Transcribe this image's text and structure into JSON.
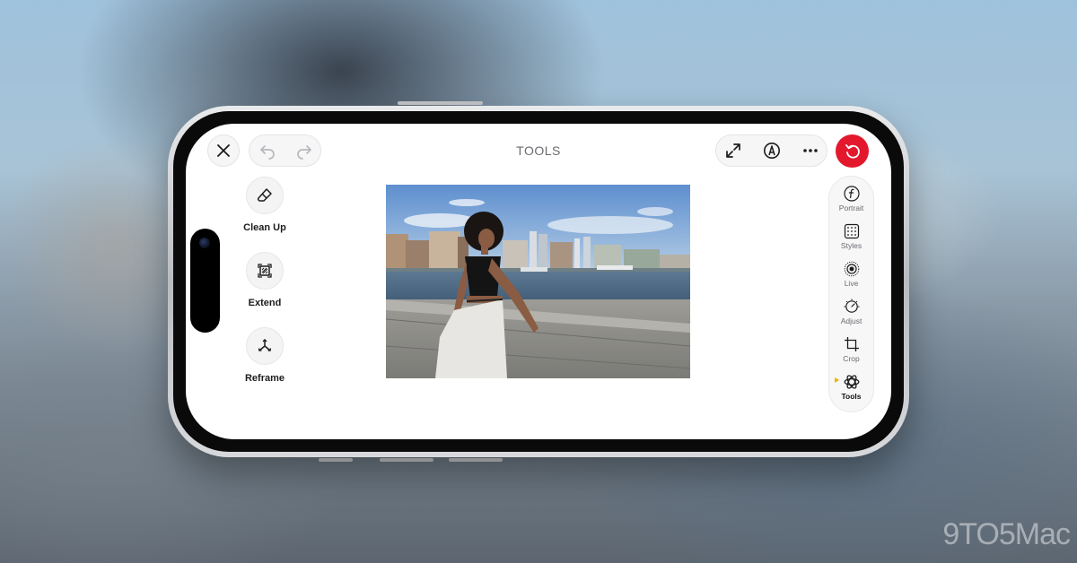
{
  "header": {
    "title": "TOOLS"
  },
  "left_tools": [
    {
      "label": "Clean Up",
      "icon": "eraser-icon"
    },
    {
      "label": "Extend",
      "icon": "extend-icon"
    },
    {
      "label": "Reframe",
      "icon": "reframe-icon"
    }
  ],
  "right_rail": [
    {
      "label": "Portrait",
      "icon": "portrait-f-icon"
    },
    {
      "label": "Styles",
      "icon": "styles-grid-icon"
    },
    {
      "label": "Live",
      "icon": "live-icon"
    },
    {
      "label": "Adjust",
      "icon": "adjust-dial-icon"
    },
    {
      "label": "Crop",
      "icon": "crop-icon"
    },
    {
      "label": "Tools",
      "icon": "tools-icon",
      "active": true
    }
  ],
  "toolbar": {
    "close": "close-icon",
    "undo": "undo-icon",
    "redo": "redo-icon",
    "expand": "expand-icon",
    "markup": "markup-pen-icon",
    "more": "more-icon",
    "revert": "revert-icon"
  },
  "colors": {
    "revert_red": "#e3182d",
    "active_indicator": "#f2b100"
  },
  "watermark": "9TO5Mac"
}
